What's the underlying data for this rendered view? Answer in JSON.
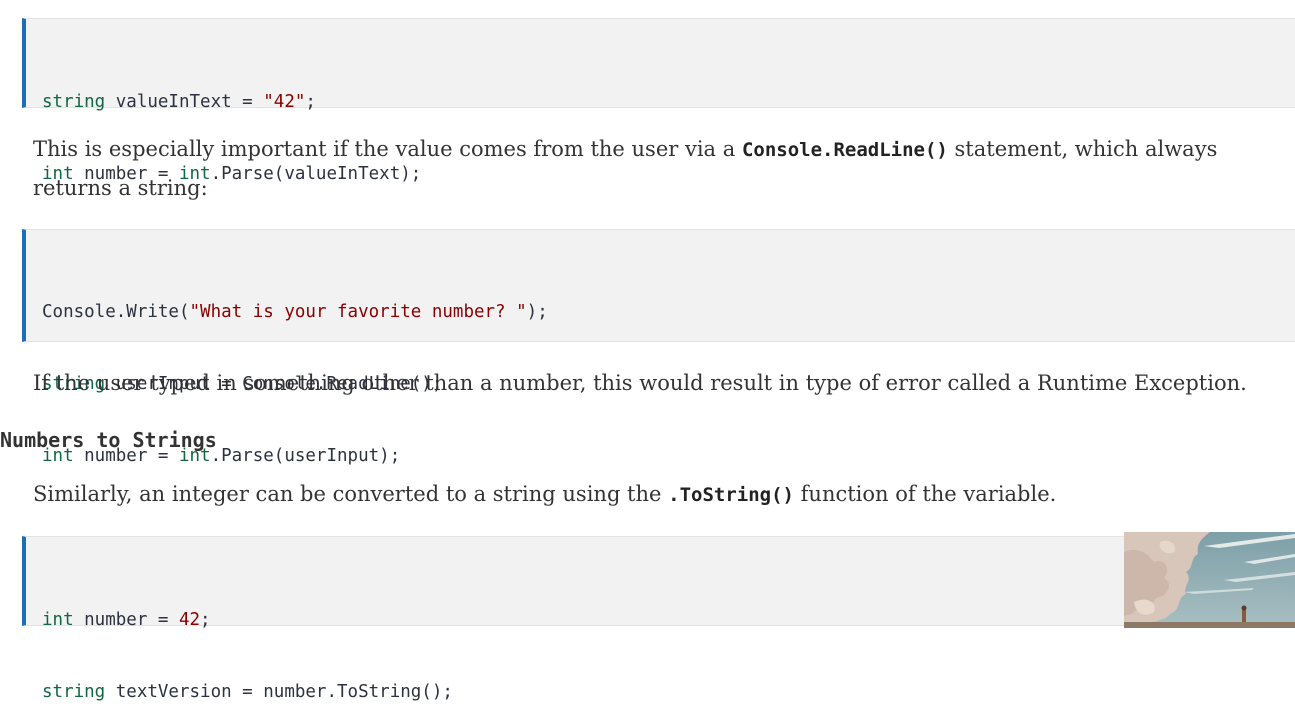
{
  "code_block_1": {
    "lines": [
      [
        {
          "t": "string",
          "c": "kw"
        },
        {
          "t": " valueInText = ",
          "c": ""
        },
        {
          "t": "\"42\"",
          "c": "str"
        },
        {
          "t": ";",
          "c": ""
        }
      ],
      [
        {
          "t": "int",
          "c": "kw"
        },
        {
          "t": " number = ",
          "c": ""
        },
        {
          "t": "int",
          "c": "kw"
        },
        {
          "t": ".Parse(valueInText);",
          "c": ""
        }
      ]
    ]
  },
  "paragraph_1": {
    "before": "This is especially important if the value comes from the user via a ",
    "code": "Console.ReadLine()",
    "after": " statement, which always returns a string:"
  },
  "code_block_2": {
    "lines": [
      [
        {
          "t": "Console.Write(",
          "c": ""
        },
        {
          "t": "\"What is your favorite number? \"",
          "c": "str"
        },
        {
          "t": ");",
          "c": ""
        }
      ],
      [
        {
          "t": "string",
          "c": "kw"
        },
        {
          "t": " userInput = Console.ReadLine();",
          "c": ""
        }
      ],
      [
        {
          "t": "int",
          "c": "kw"
        },
        {
          "t": " number = ",
          "c": ""
        },
        {
          "t": "int",
          "c": "kw"
        },
        {
          "t": ".Parse(userInput);",
          "c": ""
        }
      ]
    ]
  },
  "paragraph_2": {
    "text": "If the user typed in something other than a number, this would result in type of error called a Runtime Exception."
  },
  "heading_numbers_to_strings": "Numbers to Strings",
  "paragraph_3": {
    "before": "Similarly, an integer can be converted to a string using the ",
    "code": ".ToString()",
    "after": " function of the variable."
  },
  "code_block_3": {
    "lines": [
      [
        {
          "t": "int",
          "c": "kw"
        },
        {
          "t": " number = ",
          "c": ""
        },
        {
          "t": "42",
          "c": "num"
        },
        {
          "t": ";",
          "c": ""
        }
      ],
      [
        {
          "t": "string",
          "c": "kw"
        },
        {
          "t": " textVersion = number.ToString();",
          "c": ""
        }
      ]
    ]
  },
  "colors": {
    "code_background": "#f2f2f2",
    "code_border": "#1a6fb5",
    "keyword": "#116644",
    "string_literal": "#8b0000",
    "body_text": "#333333"
  },
  "thumbnail": {
    "icon": "landscape-thumbnail-icon"
  }
}
